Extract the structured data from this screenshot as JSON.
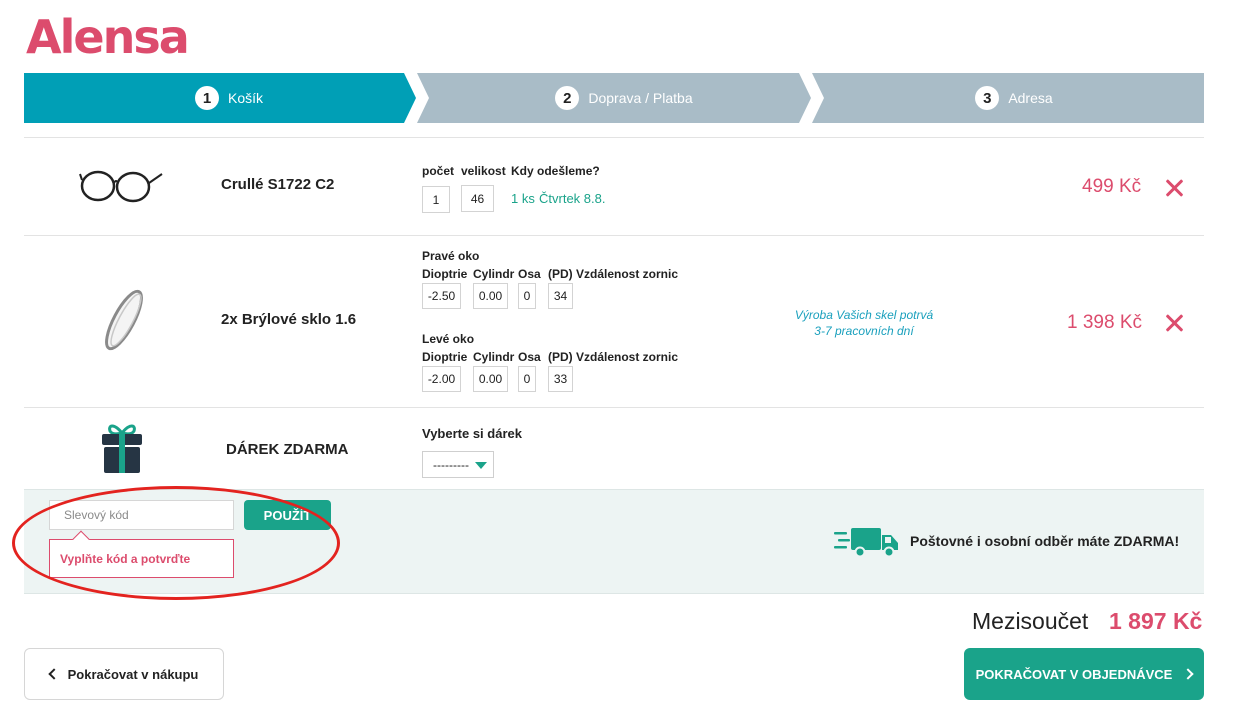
{
  "brand": {
    "logo": "Alensa"
  },
  "steps": [
    {
      "num": "1",
      "label": "Košík"
    },
    {
      "num": "2",
      "label": "Doprava / Platba"
    },
    {
      "num": "3",
      "label": "Adresa"
    }
  ],
  "cart": {
    "item1": {
      "name": "Crullé S1722 C2",
      "col_qty": "počet",
      "col_size": "velikost",
      "col_ship": "Kdy odešleme?",
      "qty": "1",
      "size": "46",
      "ship_qty": "1 ks",
      "ship_date": "Čtvrtek 8.8.",
      "price": "499 Kč"
    },
    "item2": {
      "name": "2x Brýlové sklo 1.6",
      "right_title": "Pravé oko",
      "left_title": "Levé oko",
      "headers": {
        "dioptrie": "Dioptrie",
        "cylindr": "Cylindr",
        "osa": "Osa",
        "pd": "(PD) Vzdálenost zornic"
      },
      "right": {
        "dioptrie": "-2.50",
        "cylindr": "0.00",
        "osa": "0",
        "pd": "34"
      },
      "left": {
        "dioptrie": "-2.00",
        "cylindr": "0.00",
        "osa": "0",
        "pd": "33"
      },
      "production_line1": "Výroba Vašich skel potrvá",
      "production_line2": "3-7 pracovních dní",
      "price": "1 398 Kč"
    },
    "gift": {
      "name": "DÁREK ZDARMA",
      "label": "Vyberte si dárek",
      "selected": "---------"
    }
  },
  "coupon": {
    "placeholder": "Slevový kód",
    "apply": "POUŽÍT",
    "error": "Vyplňte kód a potvrďte"
  },
  "shipping_note": "Poštovné i osobní odběr máte ZDARMA!",
  "summary": {
    "label": "Mezisoučet",
    "value": "1 897 Kč"
  },
  "nav": {
    "back": "Pokračovat v nákupu",
    "next": "POKRAČOVAT V OBJEDNÁVCE"
  },
  "colors": {
    "brand": "#dc4c6d",
    "active_step": "#009fb6",
    "inactive_step": "#a9bcc7",
    "accent": "#1aa38a"
  }
}
